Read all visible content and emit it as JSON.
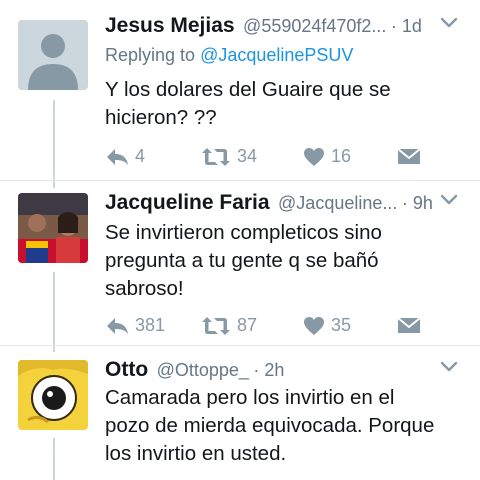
{
  "tweets": [
    {
      "name": "Jesus Mejias",
      "handle": "@559024f470f2...",
      "time": "· 1d",
      "replying_prefix": "Replying to",
      "replying_handle": "@JacquelinePSUV",
      "text": "Y los dolares del Guaire que se\nhicieron? ??",
      "replies": "4",
      "retweets": "34",
      "likes": "16",
      "avatar": "default-egg-avatar"
    },
    {
      "name": "Jacqueline Faria",
      "handle": "@Jacqueline...",
      "time": "· 9h",
      "text": "Se invirtieron completicos sino\npregunta a tu gente q se bañó\nsabroso!",
      "replies": "381",
      "retweets": "87",
      "likes": "35",
      "avatar": "photo-avatar"
    },
    {
      "name": "Otto",
      "handle": "@Ottoppe_",
      "time": "· 2h",
      "text": "Camarada pero los invirtio en el\npozo de mierda equivocada. Porque\nlos invirtio en usted.",
      "avatar": "cartoon-eye-avatar"
    }
  ],
  "colors": {
    "name": "#14171a",
    "muted": "#657786",
    "icon": "#8899a6",
    "link": "#1b95e0",
    "divider": "#e1e8ed",
    "thread_line": "#ccd6dd"
  }
}
